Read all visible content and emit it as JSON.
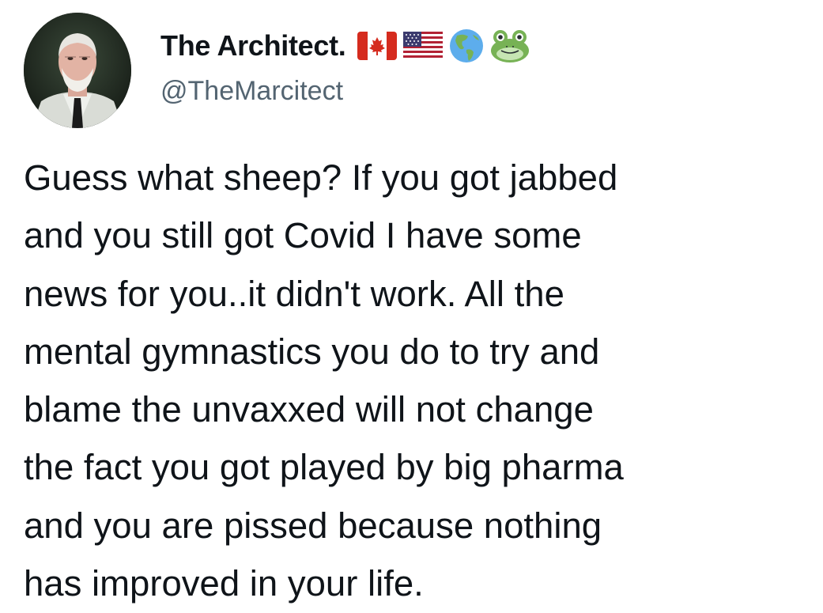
{
  "tweet": {
    "author": {
      "display_name": "The Architect.",
      "handle": "@TheMarcitect",
      "avatar": "profile-photo",
      "name_emojis": [
        "canada-flag-icon",
        "us-flag-icon",
        "globe-americas-icon",
        "frog-icon"
      ]
    },
    "text_lines": [
      "Guess what sheep? If you got jabbed",
      "and you still got Covid I have some",
      "news for you..it didn't work. All the",
      "mental gymnastics you do to try and",
      "blame the unvaxxed will not change",
      "the fact you got played by big pharma",
      "and you are pissed because nothing",
      "has improved in your life."
    ]
  },
  "colors": {
    "text": "#0f1419",
    "handle": "#536471",
    "background": "#ffffff"
  }
}
